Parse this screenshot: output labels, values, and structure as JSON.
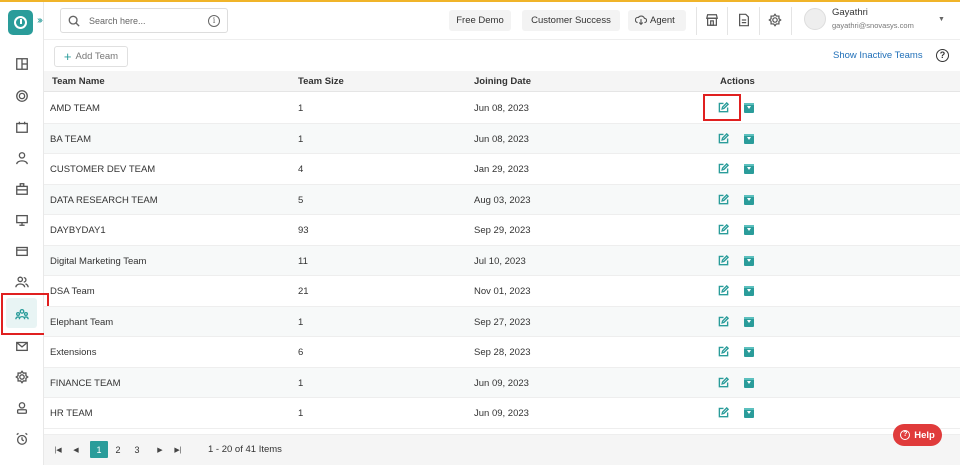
{
  "header": {
    "search_placeholder": "Search here...",
    "buttons": [
      "Free Demo",
      "Customer Success",
      "Agent"
    ],
    "user": {
      "name": "Gayathri",
      "email": "gayathri@snovasys.com"
    }
  },
  "sidebar": {
    "icons": [
      "dashboard-icon",
      "target-icon",
      "calendar-icon",
      "user-icon",
      "briefcase-icon",
      "monitor-icon",
      "card-icon",
      "users-icon",
      "teams-icon",
      "mail-icon",
      "settings-icon",
      "profile-icon",
      "alarm-icon"
    ],
    "active": "teams-icon"
  },
  "toolbar": {
    "add_label": "Add Team",
    "show_inactive": "Show Inactive Teams"
  },
  "table": {
    "columns": [
      "Team Name",
      "Team Size",
      "Joining Date",
      "Actions"
    ],
    "rows": [
      [
        "AMD TEAM",
        "1",
        "Jun 08, 2023"
      ],
      [
        "BA TEAM",
        "1",
        "Jun 08, 2023"
      ],
      [
        "CUSTOMER DEV TEAM",
        "4",
        "Jan 29, 2023"
      ],
      [
        "DATA RESEARCH TEAM",
        "5",
        "Aug 03, 2023"
      ],
      [
        "DAYBYDAY1",
        "93",
        "Sep 29, 2023"
      ],
      [
        "Digital Marketing Team",
        "11",
        "Jul 10, 2023"
      ],
      [
        "DSA Team",
        "21",
        "Nov 01, 2023"
      ],
      [
        "Elephant Team",
        "1",
        "Sep 27, 2023"
      ],
      [
        "Extensions",
        "6",
        "Sep 28, 2023"
      ],
      [
        "FINANCE TEAM",
        "1",
        "Jun 09, 2023"
      ],
      [
        "HR TEAM",
        "1",
        "Jun 09, 2023"
      ]
    ]
  },
  "pager": {
    "pages": [
      "1",
      "2",
      "3"
    ],
    "current": "1",
    "info": "1 - 20 of 41 Items"
  },
  "help_label": "Help",
  "colors": {
    "accent": "#2a9c9a",
    "highlight": "#e02020",
    "help": "#e03b3b",
    "link": "#1f6fb8"
  }
}
